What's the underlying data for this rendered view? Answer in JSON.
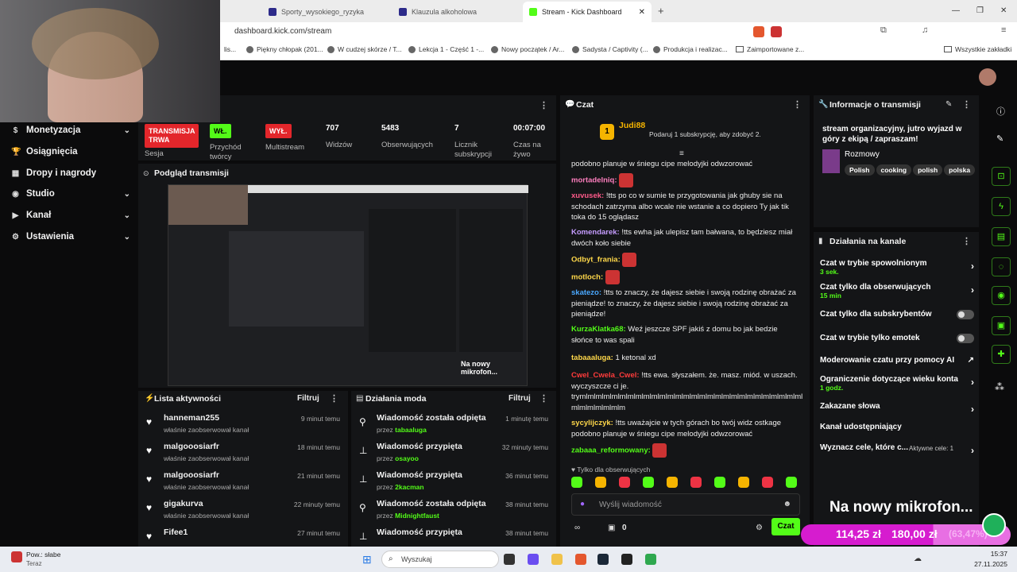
{
  "browser": {
    "tabs": [
      {
        "title": "Sporty_wysokiego_ryzyka"
      },
      {
        "title": "Klauzula alkoholowa"
      },
      {
        "title": "Stream - Kick Dashboard"
      }
    ],
    "url": "dashboard.kick.com/stream",
    "bookmarks": [
      "lis...",
      "Piękny chłopak (201...",
      "W cudzej skórze / T...",
      "Lekcja 1 - Część 1 -...",
      "Nowy początek / Ar...",
      "Sadysta / Captivity (...",
      "Produkcja i realizac...",
      "Zaimportowane z..."
    ],
    "all_bookmarks": "Wszystkie zakładki"
  },
  "sidebar": {
    "items": [
      {
        "label": "Monetyzacja",
        "icon": "dollar-icon"
      },
      {
        "label": "Osiągnięcia",
        "icon": "trophy-icon"
      },
      {
        "label": "Dropy i nagrody",
        "icon": "gift-icon"
      },
      {
        "label": "Studio",
        "icon": "studio-icon"
      },
      {
        "label": "Kanał",
        "icon": "channel-icon"
      },
      {
        "label": "Ustawienia",
        "icon": "gear-icon"
      }
    ]
  },
  "stats": {
    "session_status": "TRANSMISJA TRWA",
    "session_label": "Sesja",
    "creator_flow_status": "WŁ.",
    "creator_flow_label": "Przychód twórcy",
    "multistream_status": "WYŁ.",
    "multistream_label": "Multistream",
    "viewers": "707",
    "viewers_label": "Widzów",
    "followers": "5483",
    "followers_label": "Obserwujących",
    "subs": "7",
    "subs_label": "Licznik subskrypcji",
    "time": "00:07:00",
    "time_label": "Czas na żywo"
  },
  "preview": {
    "title": "Podgląd transmisji",
    "overlay_text": "Na nowy mikrofon..."
  },
  "activity": {
    "title": "Lista aktywności",
    "filter": "Filtruj",
    "items": [
      {
        "user": "hanneman255",
        "action": "właśnie zaobserwował kanał",
        "time": "9 minut temu"
      },
      {
        "user": "malgooosiarfr",
        "action": "właśnie zaobserwował kanał",
        "time": "18 minut temu"
      },
      {
        "user": "malgooosiarfr",
        "action": "właśnie zaobserwował kanał",
        "time": "21 minut temu"
      },
      {
        "user": "gigakurva",
        "action": "właśnie zaobserwował kanał",
        "time": "22 minuty temu"
      },
      {
        "user": "Fifee1",
        "action": "",
        "time": "27 minut temu"
      }
    ]
  },
  "mod": {
    "title": "Działania moda",
    "filter": "Filtruj",
    "items": [
      {
        "action": "Wiadomość została odpięta",
        "by": "przez",
        "user": "tabaaluga",
        "time": "1 minutę temu"
      },
      {
        "action": "Wiadomość przypięta",
        "by": "przez",
        "user": "osayoo",
        "time": "32 minuty temu"
      },
      {
        "action": "Wiadomość przypięta",
        "by": "przez",
        "user": "2kacman",
        "time": "36 minut temu"
      },
      {
        "action": "Wiadomość została odpięta",
        "by": "przez",
        "user": "Midnightfaust",
        "time": "38 minut temu"
      },
      {
        "action": "Wiadomość przypięta",
        "by": "",
        "user": "",
        "time": "38 minut temu"
      }
    ]
  },
  "chat": {
    "title": "Czat",
    "top_user": "Judi88",
    "top_user_count": "1",
    "gift_prompt": "Podaruj 1 subskrypcję, aby zdobyć 2.",
    "messages": [
      {
        "user": "",
        "text": "podobno planuje w śniegu cipe melodyjki odwzorować",
        "color": "#eeeeee"
      },
      {
        "user": "mortadelniq:",
        "text": "",
        "color": "#ff7fbf",
        "emote": true
      },
      {
        "user": "xuvusek:",
        "text": "!tts po co w sumie te przygotowania jak ghuby sie na schodach zatrzyma albo wcale nie wstanie a co dopiero Ty jak tik toka do 15 oglądasz",
        "color": "#ff5a8a"
      },
      {
        "user": "Komendarek:",
        "text": "!tts ewha jak ulepisz tam bałwana, to będziesz miał dwóch koło siebie",
        "color": "#c59cff"
      },
      {
        "user": "Odbyt_frania:",
        "text": "",
        "color": "#ffd84a",
        "emote": true
      },
      {
        "user": "motloch:",
        "text": "",
        "color": "#ffd84a",
        "emote": true
      },
      {
        "user": "skatezo:",
        "text": "!tts to znaczy, że dajesz siebie i swoją rodzinę obrażać za pieniądze! to znaczy, że dajesz siebie i swoją rodzinę obrażać za pieniądze!",
        "color": "#4aa8ff"
      },
      {
        "user": "KurzaKlatka68:",
        "text": "Weź jeszcze SPF jakiś z domu bo jak bedzie słońce to was spali",
        "color": "#53fc18"
      },
      {
        "user": "tabaaaluga:",
        "text": "1 ketonal xd",
        "color": "#ffd84a"
      },
      {
        "user": "Cwel_Cwela_Cwel:",
        "text": "!tts ewa. słyszałem. że. masz. miód. w uszach. wyczyszcze ci je. trymlmlmlmlmlmlmlmlmlmlmlmlmlmlmlmlmlmlmlmlmlmlmlmlmlmlmlml mlmlmlmlmlmlm",
        "color": "#ff3b3b"
      },
      {
        "user": "sycylijczyk:",
        "text": "!tts uważajcie w tych górach bo twój widz ostkage podobno planuje w śniegu cipe melodyjki odwzorować",
        "color": "#ffd84a"
      },
      {
        "user": "zabaaa_reformowany:",
        "text": "",
        "color": "#53fc18",
        "emote": true
      }
    ],
    "followers_only": "Tylko dla obserwujących",
    "input_placeholder": "Wyślij wiadomość",
    "points": "0",
    "send": "Czat"
  },
  "info": {
    "title": "Informacje o transmisji",
    "stream_title": "stream organizacyjny, jutro wyjazd w góry z ekipą / zapraszam!",
    "category": "Rozmowy",
    "tags": [
      "Polish",
      "cooking",
      "polish",
      "polska"
    ]
  },
  "channel": {
    "title": "Działania na kanale",
    "items": [
      {
        "label": "Czat w trybie spowolnionym",
        "sub": "3 sek.",
        "control": "chevron"
      },
      {
        "label": "Czat tylko dla obserwujących",
        "sub": "15 min",
        "control": "chevron"
      },
      {
        "label": "Czat tylko dla subskrybentów",
        "sub": "",
        "control": "toggle"
      },
      {
        "label": "Czat w trybie tylko emotek",
        "sub": "",
        "control": "toggle"
      },
      {
        "label": "Moderowanie czatu przy pomocy AI",
        "sub": "",
        "control": "external"
      },
      {
        "label": "Ograniczenie dotyczące wieku konta",
        "sub": "1 godz.",
        "control": "chevron"
      },
      {
        "label": "Zakazane słowa",
        "sub": "",
        "control": "chevron"
      },
      {
        "label": "Kanał udostępniający",
        "sub": "",
        "control": "none"
      },
      {
        "label": "Wyznacz cele, które c...",
        "sub": "",
        "control": "chevron"
      }
    ],
    "active_goals": "Aktywne cele: 1"
  },
  "overlay": {
    "mic_text": "Na nowy mikrofon...",
    "amount1": "114,25 zł",
    "amount2": "180,00 zł",
    "percent": "(63,47%)"
  },
  "taskbar": {
    "weather": "Pow.: słabe",
    "weather_sub": "Teraz",
    "search": "Wyszukaj",
    "time": "15:37",
    "date": "27.11.2025"
  },
  "colors": {
    "accent": "#53fc18",
    "live": "#e3262b",
    "bg": "#0b0b0c",
    "card": "#141517"
  }
}
